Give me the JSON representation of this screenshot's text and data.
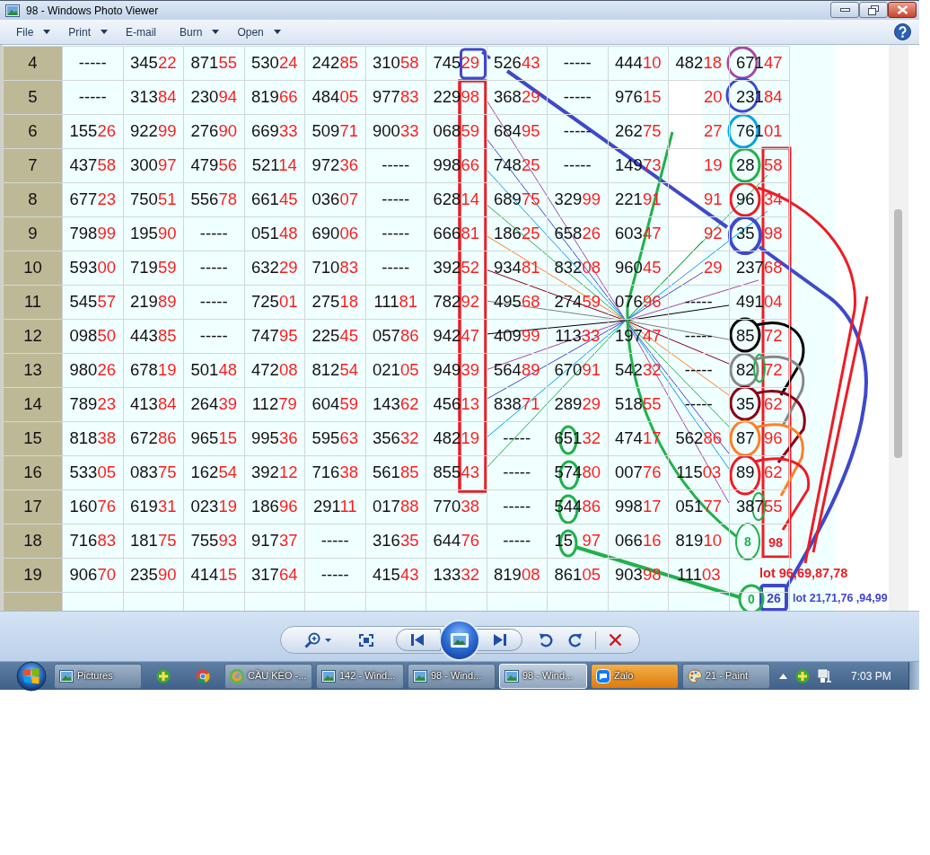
{
  "window": {
    "title": "98 - Windows Photo Viewer"
  },
  "menu": [
    {
      "label": "File",
      "dropdown": true
    },
    {
      "label": "Print",
      "dropdown": true
    },
    {
      "label": "E-mail",
      "dropdown": false
    },
    {
      "label": "Burn",
      "dropdown": true
    },
    {
      "label": "Open",
      "dropdown": true
    }
  ],
  "photo": {
    "table": {
      "rows": [
        {
          "label": "4",
          "cells": [
            "-----",
            "34522",
            "87155",
            "53024",
            "24285",
            "31058",
            "74529",
            "52643",
            "-----",
            "44410",
            "48218",
            "67147"
          ]
        },
        {
          "label": "5",
          "cells": [
            "-----",
            "31384",
            "23094",
            "81966",
            "48405",
            "97783",
            "22998",
            "36829",
            "-----",
            "97615",
            "20",
            "23184"
          ]
        },
        {
          "label": "6",
          "cells": [
            "15526",
            "92299",
            "27690",
            "66933",
            "50971",
            "90033",
            "06859",
            "68495",
            "-----",
            "26275",
            "27",
            "76101"
          ]
        },
        {
          "label": "7",
          "cells": [
            "43758",
            "30097",
            "47956",
            "52114",
            "97236",
            "-----",
            "99866",
            "74825",
            "-----",
            "14973",
            "19",
            "28 58"
          ]
        },
        {
          "label": "8",
          "cells": [
            "67723",
            "75051",
            "55678",
            "66145",
            "03607",
            "-----",
            "62814",
            "68975",
            "32999",
            "22191",
            "91",
            "96 34"
          ]
        },
        {
          "label": "9",
          "cells": [
            "79899",
            "19590",
            "-----",
            "05148",
            "69006",
            "-----",
            "66681",
            "18625",
            "65826",
            "60347",
            "92",
            "35 98"
          ]
        },
        {
          "label": "10",
          "cells": [
            "59300",
            "71959",
            "-----",
            "63229",
            "71083",
            "-----",
            "39252",
            "93481",
            "83208",
            "96045",
            "29",
            "23768"
          ]
        },
        {
          "label": "11",
          "cells": [
            "54557",
            "21989",
            "-----",
            "72501",
            "27518",
            "11181",
            "78292",
            "49568",
            "27459",
            "07696",
            "-----",
            "49104"
          ]
        },
        {
          "label": "12",
          "cells": [
            "09850",
            "44385",
            "-----",
            "74795",
            "22545",
            "05786",
            "94247",
            "40999",
            "11333",
            "19747",
            "-----",
            "85 72"
          ]
        },
        {
          "label": "13",
          "cells": [
            "98026",
            "67819",
            "50148",
            "47208",
            "81254",
            "02105",
            "94939",
            "56489",
            "67091",
            "54232",
            "-----",
            "82 72"
          ]
        },
        {
          "label": "14",
          "cells": [
            "78923",
            "41384",
            "26439",
            "11279",
            "60459",
            "14362",
            "45613",
            "83871",
            "28929",
            "51855",
            "-----",
            "35 62"
          ]
        },
        {
          "label": "15",
          "cells": [
            "81838",
            "67286",
            "96515",
            "99536",
            "59563",
            "35632",
            "48219",
            "-----",
            "65132",
            "47417",
            "56286",
            "87 96"
          ]
        },
        {
          "label": "16",
          "cells": [
            "53305",
            "08375",
            "16254",
            "39212",
            "71638",
            "56185",
            "85543",
            "-----",
            "57480",
            "00776",
            "11503",
            "89 62"
          ]
        },
        {
          "label": "17",
          "cells": [
            "16076",
            "61931",
            "02319",
            "18696",
            "29111",
            "01788",
            "77038",
            "-----",
            "54486",
            "99817",
            "05177",
            "38755"
          ]
        },
        {
          "label": "18",
          "cells": [
            "71683",
            "18175",
            "75593",
            "91737",
            "-----",
            "31635",
            "64476",
            "-----",
            "15 97",
            "06616",
            "81910"
          ]
        },
        {
          "label": "19",
          "cells": [
            "90670",
            "23590",
            "41415",
            "31764",
            "-----",
            "41543",
            "13332",
            "81908",
            "86105",
            "90398",
            "11103"
          ]
        }
      ]
    },
    "notes": [
      {
        "text": "8",
        "color": "#22b14c"
      },
      {
        "text": "98",
        "color": "#ed1c24"
      },
      {
        "text": "lot 96,69,87,78",
        "color": "#ed1c24"
      },
      {
        "text": "0",
        "color": "#22b14c"
      },
      {
        "text": "26",
        "color": "#3f48cc"
      },
      {
        "text": "lot 21,71,76 ,94,99",
        "color": "#3f48cc"
      }
    ]
  },
  "taskbar": {
    "items": [
      {
        "kind": "viewer",
        "label": "Pictures",
        "selected": false,
        "attention": false
      },
      {
        "kind": "addon",
        "selected": false,
        "attention": false
      },
      {
        "kind": "browser",
        "selected": false,
        "attention": false
      },
      {
        "kind": "web",
        "label": "CẦU KÈO -...",
        "selected": false,
        "attention": false
      },
      {
        "kind": "viewer",
        "label": "142 - Wind...",
        "selected": false,
        "attention": false
      },
      {
        "kind": "viewer",
        "label": "98 - Wind...",
        "selected": false,
        "attention": false
      },
      {
        "kind": "viewer",
        "label": "98 - Wind...",
        "selected": true,
        "attention": false
      },
      {
        "kind": "chat",
        "label": "Zalo",
        "selected": false,
        "attention": true
      },
      {
        "kind": "paint",
        "label": "21 - Paint",
        "selected": false,
        "attention": false
      }
    ],
    "clock": "7:03 PM"
  }
}
